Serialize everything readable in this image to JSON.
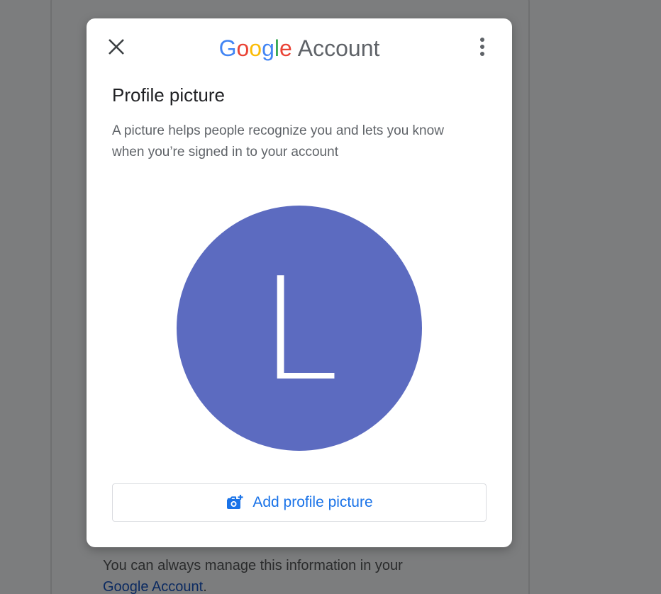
{
  "background": {
    "manage_text": "You can always manage this information in your",
    "manage_link": "Google Account",
    "manage_suffix": "."
  },
  "dialog": {
    "brand": {
      "letters": [
        "G",
        "o",
        "o",
        "g",
        "l",
        "e"
      ],
      "product": "Account"
    },
    "title": "Profile picture",
    "description": "A picture helps people recognize you and lets you know when you’re signed in to your account",
    "avatar": {
      "letter": "L",
      "color": "#5c6bc0"
    },
    "add_button": {
      "label": "Add profile picture",
      "icon": "add-photo-icon"
    },
    "close_icon": "close-icon",
    "more_icon": "more-vert-icon"
  },
  "colors": {
    "accent": "#1a73e8",
    "google_blue": "#4285f4",
    "google_red": "#ea4335",
    "google_yellow": "#fbbc05",
    "google_green": "#34a853",
    "overlay": "#7c7d7e"
  }
}
